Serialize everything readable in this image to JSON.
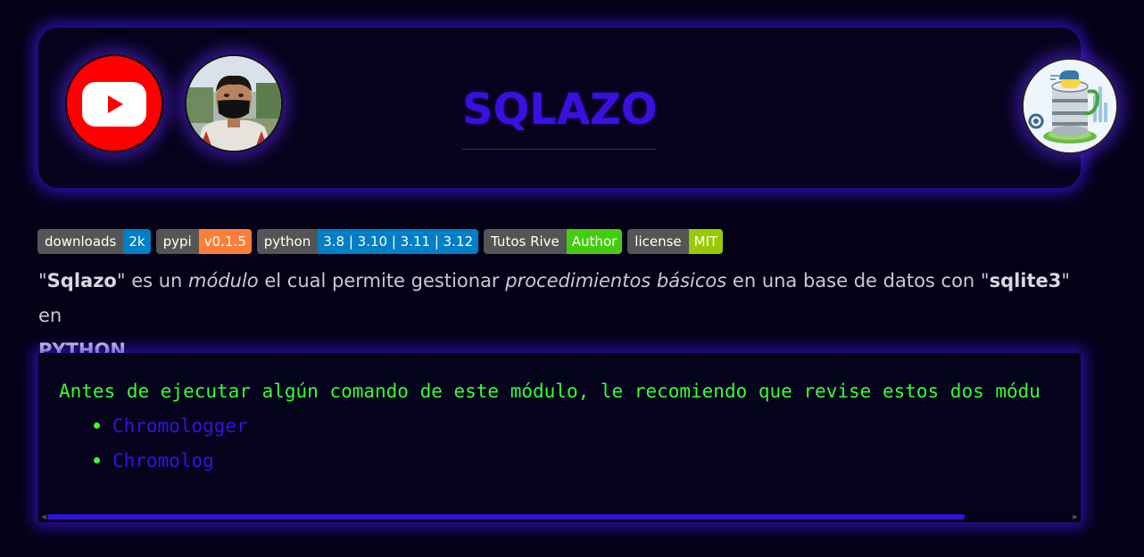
{
  "header": {
    "title": "SQLAZO",
    "youtube_icon": "youtube-icon",
    "author_avatar": "author-avatar",
    "logo": "sqlite-python-logo"
  },
  "badges": [
    {
      "label": "downloads",
      "value": "2k",
      "color": "#007ec6"
    },
    {
      "label": "pypi",
      "value": "v0.1.5",
      "color": "#fe7d37"
    },
    {
      "label": "python",
      "value": "3.8 | 3.10 | 3.11 | 3.12",
      "color": "#007ec6"
    },
    {
      "label": "Tutos Rive",
      "value": "Author",
      "color": "#4c1"
    },
    {
      "label": "license",
      "value": "MIT",
      "color": "#97ca00"
    }
  ],
  "description": {
    "q1": "\"",
    "name": "Sqlazo",
    "t1": "\" es un ",
    "em1": "módulo",
    "t2": " el cual permite gestionar ",
    "em2": "procedimientos básicos",
    "t3": " en una base de datos con \"",
    "b2": "sqlite3",
    "t4": "\" en",
    "b3": "PYTHON",
    "t5": "."
  },
  "code_block": {
    "intro": "Antes de ejecutar algún comando de este módulo, le recomiendo que revise estos dos módu",
    "links": [
      "Chromologger",
      "Chromolog"
    ]
  },
  "colors": {
    "background": "#050218",
    "accent": "#3a10e0",
    "code_green": "#33ff33",
    "glow": "#3c14dc"
  }
}
